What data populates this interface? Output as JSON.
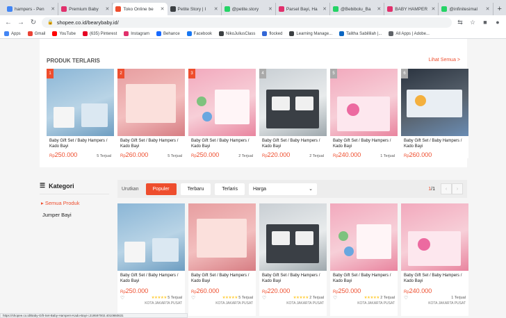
{
  "browser": {
    "tabs": [
      {
        "title": "hampers - Pen",
        "color": "#4285f4",
        "active": false
      },
      {
        "title": "Premium Baby",
        "color": "#e1306c",
        "active": false
      },
      {
        "title": "Toko Online be",
        "color": "#ee4d2d",
        "active": true
      },
      {
        "title": "Petite Story | I",
        "color": "#3c4043",
        "active": false
      },
      {
        "title": "@petite.story",
        "color": "#25d366",
        "active": false
      },
      {
        "title": "Parsel Bayi, Ha",
        "color": "#e1306c",
        "active": false
      },
      {
        "title": "@Bebibolu_Ba",
        "color": "#25d366",
        "active": false
      },
      {
        "title": "BABY HAMPER",
        "color": "#e1306c",
        "active": false
      },
      {
        "title": "@infinitesimal",
        "color": "#25d366",
        "active": false
      }
    ],
    "new_tab": "+",
    "url": "shopee.co.id/bearybaby.id/",
    "bookmarks": [
      {
        "label": "Apps",
        "color": "#4285f4"
      },
      {
        "label": "Gmail",
        "color": "#ea4335"
      },
      {
        "label": "YouTube",
        "color": "#ff0000"
      },
      {
        "label": "(635) Pinterest",
        "color": "#e60023"
      },
      {
        "label": "Instagram",
        "color": "#e1306c"
      },
      {
        "label": "Behance",
        "color": "#1769ff"
      },
      {
        "label": "Facebook",
        "color": "#1877f2"
      },
      {
        "label": "NikoJuliusClass",
        "color": "#3c4043"
      },
      {
        "label": "flocked",
        "color": "#3367d6"
      },
      {
        "label": "Learning Manage...",
        "color": "#3c4043"
      },
      {
        "label": "Talitha Sabillilah |...",
        "color": "#0a66c2"
      },
      {
        "label": "All Apps | Adobe...",
        "color": "#5f6368"
      }
    ],
    "status_text": "https://shopee.co.id/Baby-Gift-Set-Baby-Hampers-Kado-Bayi-i.219597002.4010860631"
  },
  "top_section": {
    "title": "PRODUK TERLARIS",
    "see_all": "Lihat Semua >",
    "products": [
      {
        "rank": "1",
        "name": "Baby Gift Set / Baby Hampers / Kado Bayi",
        "currency": "Rp",
        "price": "250.000",
        "sold": "5 Terjual",
        "img": "img-blue"
      },
      {
        "rank": "2",
        "name": "Baby Gift Set / Baby Hampers / Kado Bayi",
        "currency": "Rp",
        "price": "260.000",
        "sold": "5 Terjual",
        "img": "img-pink"
      },
      {
        "rank": "3",
        "name": "Baby Gift Set / Baby Hampers / Kado Bayi",
        "currency": "Rp",
        "price": "250.000",
        "sold": "2 Terjual",
        "img": "img-rose"
      },
      {
        "rank": "4",
        "name": "Baby Gift Set / Baby Hampers / Kado Bayi",
        "currency": "Rp",
        "price": "220.000",
        "sold": "2 Terjual",
        "img": "img-gray"
      },
      {
        "rank": "5",
        "name": "Baby Gift Set / Baby Hampers / Kado Bayi",
        "currency": "Rp",
        "price": "240.000",
        "sold": "1 Terjual",
        "img": "img-rose"
      },
      {
        "rank": "6",
        "name": "Baby Gift Set / Baby Hampers / Kado Bayi",
        "currency": "Rp",
        "price": "260.000",
        "sold": "",
        "img": "img-dark"
      }
    ]
  },
  "sidebar": {
    "title": "Kategori",
    "items": [
      "Semua Produk",
      "Jumper Bayi"
    ]
  },
  "sortbar": {
    "label": "Urutkan",
    "buttons": [
      "Populer",
      "Terbaru",
      "Terlaris"
    ],
    "select_value": "Harga",
    "page_current": "1",
    "page_total": "/1"
  },
  "grid": {
    "products": [
      {
        "name": "Baby Gift Set / Baby Hampers / Kado Bayi",
        "currency": "Rp",
        "price": "250.000",
        "rating": "★★★★★",
        "sold": "5 Terjual",
        "location": "KOTA JAKARTA PUSAT",
        "img": "img-blue"
      },
      {
        "name": "Baby Gift Set / Baby Hampers / Kado Bayi",
        "currency": "Rp",
        "price": "260.000",
        "rating": "★★★★★",
        "sold": "5 Terjual",
        "location": "KOTA JAKARTA PUSAT",
        "img": "img-pink"
      },
      {
        "name": "Baby Gift Set / Baby Hampers / Kado Bayi",
        "currency": "Rp",
        "price": "220.000",
        "rating": "★★★★★",
        "sold": "2 Terjual",
        "location": "KOTA JAKARTA PUSAT",
        "img": "img-gray"
      },
      {
        "name": "Baby Gift Set / Baby Hampers / Kado Bayi",
        "currency": "Rp",
        "price": "250.000",
        "rating": "★★★★★",
        "sold": "2 Terjual",
        "location": "KOTA JAKARTA PUSAT",
        "img": "img-rose"
      },
      {
        "name": "Baby Gift Set / Baby Hampers / Kado Bayi",
        "currency": "Rp",
        "price": "240.000",
        "rating": "",
        "sold": "1 Terjual",
        "location": "KOTA JAKARTA PUSAT",
        "img": "img-rose"
      }
    ]
  },
  "colors": {
    "accent": "#ee4d2d"
  }
}
